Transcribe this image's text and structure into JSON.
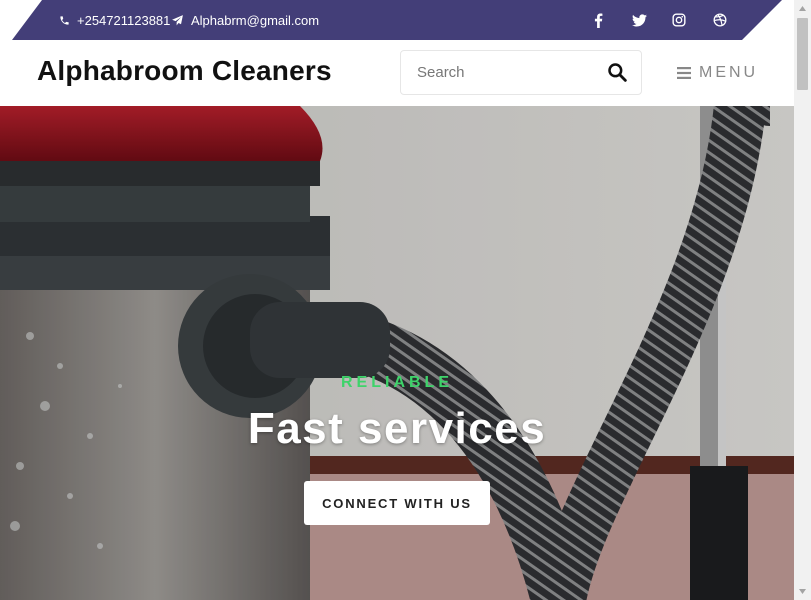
{
  "topbar": {
    "phone": "+254721123881",
    "email": "Alphabrm@gmail.com",
    "social": [
      {
        "name": "facebook",
        "icon": "facebook-icon"
      },
      {
        "name": "twitter",
        "icon": "twitter-icon"
      },
      {
        "name": "instagram",
        "icon": "instagram-icon"
      },
      {
        "name": "dribbble",
        "icon": "dribbble-icon"
      }
    ]
  },
  "header": {
    "brand": "Alphabroom Cleaners",
    "search_placeholder": "Search",
    "menu_label": "MENU"
  },
  "hero": {
    "kicker": "RELIABLE",
    "headline": "Fast services",
    "cta_label": "CONNECT WITH US"
  },
  "colors": {
    "topbar_bg": "#433e78",
    "accent_green": "#3ed36a",
    "hero_text": "#ffffff"
  }
}
